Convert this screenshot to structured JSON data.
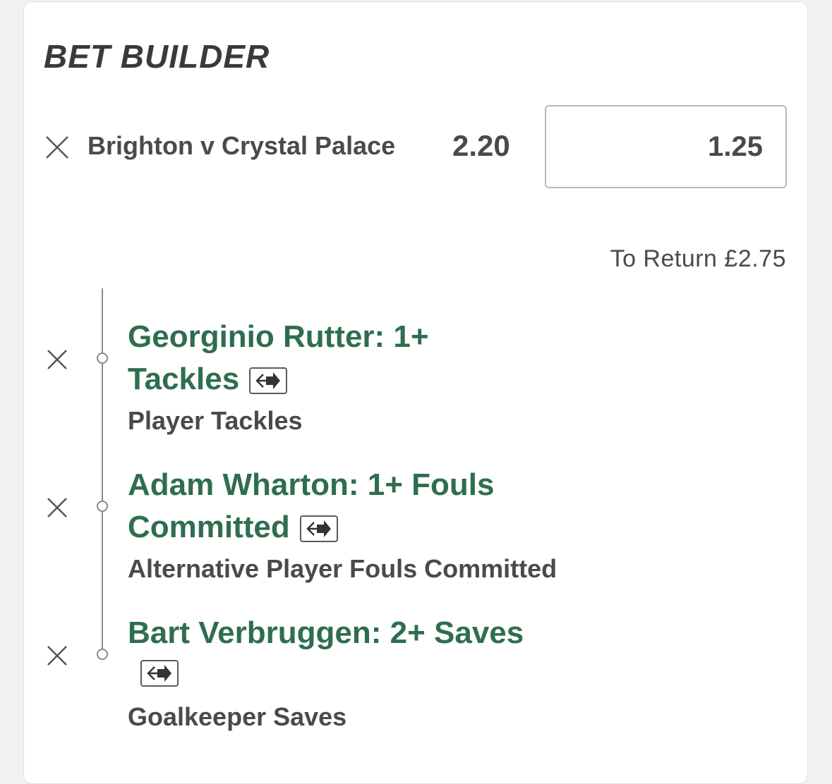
{
  "header": {
    "title": "BET BUILDER"
  },
  "bet": {
    "match": "Brighton v Crystal Palace",
    "odds": "2.20",
    "stake": "1.25",
    "to_return": "To Return £2.75"
  },
  "selections": [
    {
      "title_line1": "Georginio Rutter: 1+",
      "title_line2": "Tackles",
      "market": "Player Tackles"
    },
    {
      "title_line1": "Adam Wharton: 1+ Fouls",
      "title_line2": "Committed",
      "market": "Alternative Player Fouls Committed"
    },
    {
      "title_line1": "Bart Verbruggen: 2+ Saves",
      "title_line2": "",
      "market": "Goalkeeper Saves"
    }
  ],
  "icons": {
    "remove": "close-icon",
    "swap": "swap-arrows-icon"
  },
  "colors": {
    "selection_green": "#2e6e4e",
    "text_dark": "#4a4a4a",
    "title": "#3a3a3a"
  }
}
